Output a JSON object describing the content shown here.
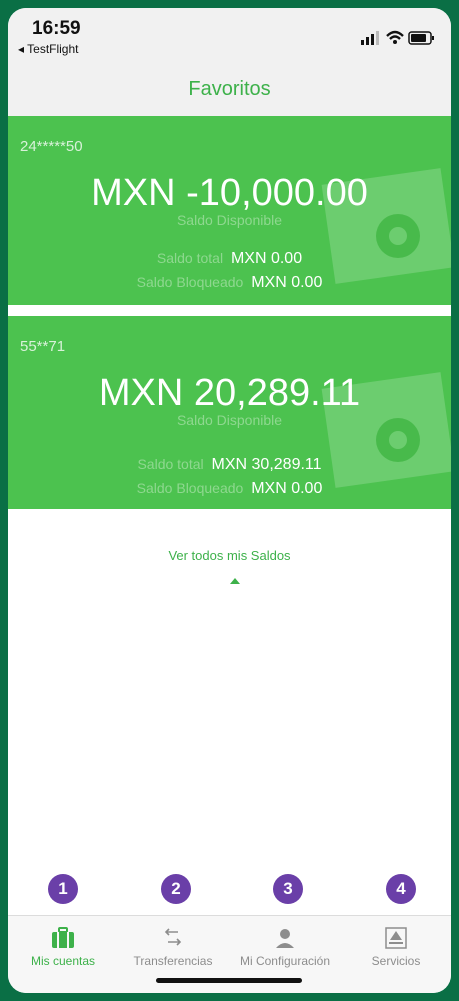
{
  "status": {
    "time": "16:59",
    "back_app": "TestFlight"
  },
  "header": {
    "title": "Favoritos"
  },
  "accounts": [
    {
      "number": "24*****50",
      "balance": "MXN -10,000.00",
      "balance_label": "Saldo Disponible",
      "total_label": "Saldo total",
      "total_value": "MXN 0.00",
      "blocked_label": "Saldo Bloqueado",
      "blocked_value": "MXN 0.00"
    },
    {
      "number": "55**71",
      "balance": "MXN 20,289.11",
      "balance_label": "Saldo Disponible",
      "total_label": "Saldo total",
      "total_value": "MXN 30,289.11",
      "blocked_label": "Saldo Bloqueado",
      "blocked_value": "MXN 0.00"
    }
  ],
  "view_all": "Ver todos mis Saldos",
  "badges": [
    "1",
    "2",
    "3",
    "4"
  ],
  "tabs": [
    {
      "label": "Mis cuentas",
      "icon": "briefcase-icon",
      "active": true
    },
    {
      "label": "Transferencias",
      "icon": "transfer-arrows-icon"
    },
    {
      "label": "Mi Configuración",
      "icon": "user-icon"
    },
    {
      "label": "Servicios",
      "icon": "services-icon"
    }
  ],
  "colors": {
    "brand_green": "#4cc24f",
    "accent_green": "#3db14a",
    "badge_purple": "#6a3fa8",
    "frame": "#0a6f45"
  }
}
